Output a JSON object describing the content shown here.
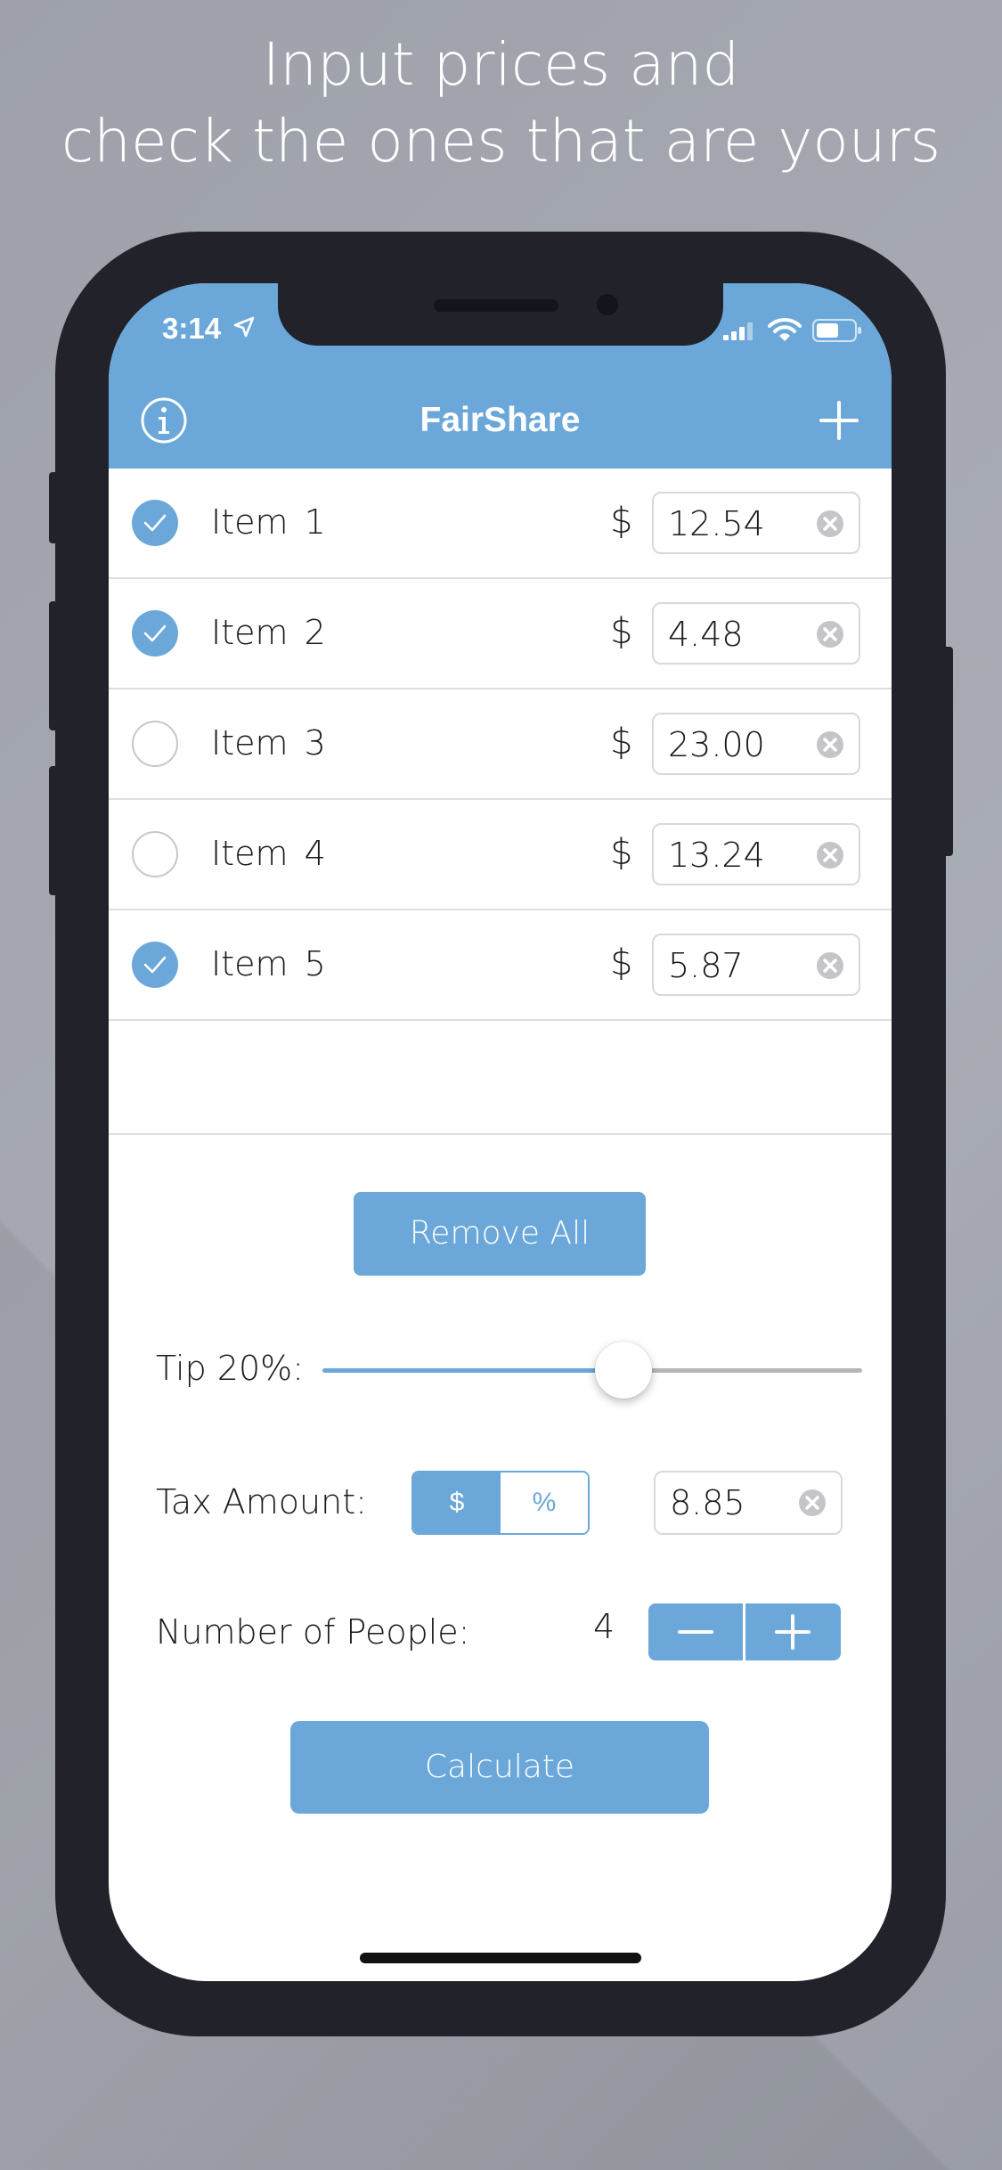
{
  "headline": {
    "line1": "Input prices and",
    "line2": "check the ones that are yours"
  },
  "status_bar": {
    "time": "3:14"
  },
  "nav": {
    "title": "FairShare",
    "info_icon": "info-icon",
    "add_icon": "plus-icon"
  },
  "items": [
    {
      "name": "Item  1",
      "currency": "$",
      "price": "12.54",
      "checked": true
    },
    {
      "name": "Item  2",
      "currency": "$",
      "price": "4.48",
      "checked": true
    },
    {
      "name": "Item  3",
      "currency": "$",
      "price": "23.00",
      "checked": false
    },
    {
      "name": "Item  4",
      "currency": "$",
      "price": "13.24",
      "checked": false
    },
    {
      "name": "Item  5",
      "currency": "$",
      "price": "5.87",
      "checked": true
    }
  ],
  "remove_all_label": "Remove All",
  "tip": {
    "label": "Tip 20%:",
    "value_fraction": 0.47
  },
  "tax": {
    "label": "Tax Amount:",
    "segment_options": [
      "$",
      "%"
    ],
    "selected_segment": "$",
    "value": "8.85"
  },
  "people": {
    "label": "Number of People:",
    "count": "4"
  },
  "calculate_label": "Calculate",
  "colors": {
    "accent": "#6ba8d9",
    "background": "#a6a9b1",
    "device": "#22232a"
  }
}
